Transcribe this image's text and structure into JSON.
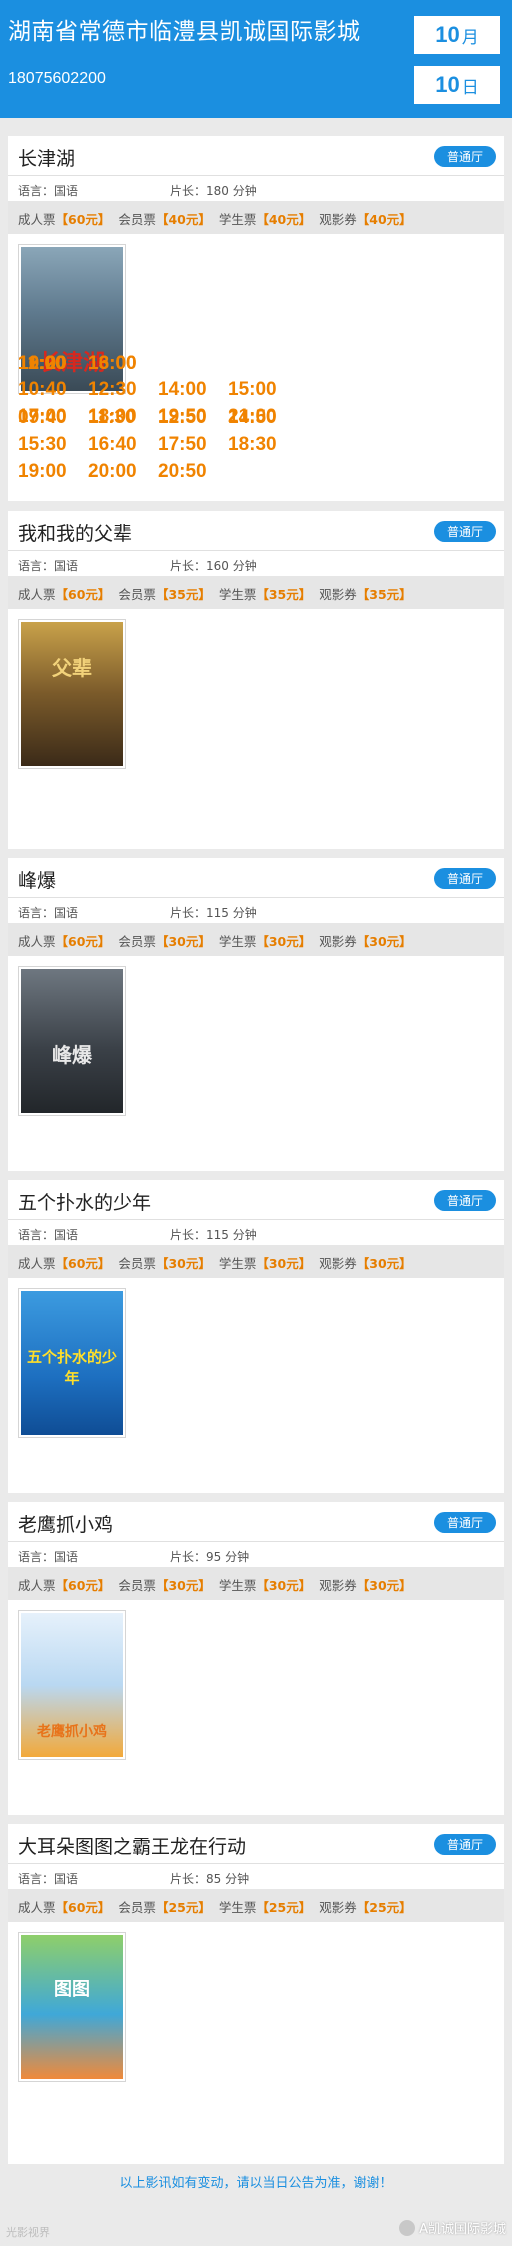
{
  "header": {
    "cinema_name": "湖南省常德市临澧县凯诚国际影城",
    "phone": "18075602200",
    "month_num": "10",
    "month_unit": "月",
    "day_num": "10",
    "day_unit": "日"
  },
  "labels": {
    "lang_prefix": "语言：",
    "duration_prefix": "片长：",
    "adult": "成人票",
    "member": "会员票",
    "student": "学生票",
    "voucher": "观影券"
  },
  "movies": [
    {
      "title": "长津湖",
      "hall": "普通厅",
      "language": "国语",
      "duration": "180 分钟",
      "prices": {
        "adult": "【60元】",
        "member": "【40元】",
        "student": "【40元】",
        "voucher": "【40元】"
      },
      "poster_text": "长津湖",
      "times": [
        "09:40",
        "11:30",
        "12:50",
        "14:50",
        "15:30",
        "16:40",
        "17:50",
        "18:30",
        "19:00",
        "20:00",
        "20:50"
      ]
    },
    {
      "title": "我和我的父辈",
      "hall": "普通厅",
      "language": "国语",
      "duration": "160 分钟",
      "prices": {
        "adult": "【60元】",
        "member": "【35元】",
        "student": "【35元】",
        "voucher": "【35元】"
      },
      "poster_text": "父辈",
      "times": [
        "10:40",
        "12:30",
        "14:00",
        "15:00",
        "17:00",
        "18:00",
        "19:50",
        "21:00"
      ]
    },
    {
      "title": "峰爆",
      "hall": "普通厅",
      "language": "国语",
      "duration": "115 分钟",
      "prices": {
        "adult": "【60元】",
        "member": "【30元】",
        "student": "【30元】",
        "voucher": "【30元】"
      },
      "poster_text": "峰爆",
      "times": [
        "10:20",
        "16:00"
      ]
    },
    {
      "title": "五个扑水的少年",
      "hall": "普通厅",
      "language": "国语",
      "duration": "115 分钟",
      "prices": {
        "adult": "【60元】",
        "member": "【30元】",
        "student": "【30元】",
        "voucher": "【30元】"
      },
      "poster_text": "五个扑水的少年",
      "times": [
        "11:00",
        "13:00"
      ]
    },
    {
      "title": "老鹰抓小鸡",
      "hall": "普通厅",
      "language": "国语",
      "duration": "95 分钟",
      "prices": {
        "adult": "【60元】",
        "member": "【30元】",
        "student": "【30元】",
        "voucher": "【30元】"
      },
      "poster_text": "老鹰抓小鸡",
      "times": [
        "10:00"
      ]
    },
    {
      "title": "大耳朵图图之霸王龙在行动",
      "hall": "普通厅",
      "language": "国语",
      "duration": "85 分钟",
      "prices": {
        "adult": "【60元】",
        "member": "【25元】",
        "student": "【25元】",
        "voucher": "【25元】"
      },
      "poster_text": "图图",
      "times": [
        "12:00"
      ]
    }
  ],
  "footer": {
    "notice": "以上影讯如有变动，请以当日公告为准，谢谢！",
    "watermark_left": "光影视界",
    "watermark_right": "A凯诚国际影城"
  }
}
